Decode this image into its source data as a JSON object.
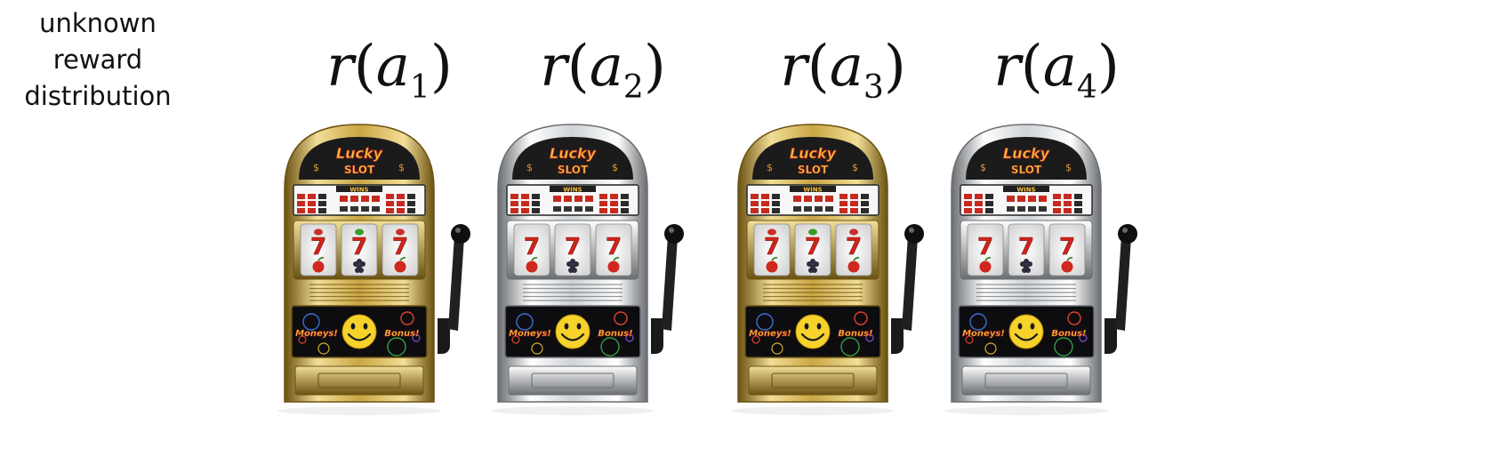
{
  "side_label": {
    "lines": [
      "unknown",
      "reward",
      "distribution"
    ]
  },
  "machines": [
    {
      "fn": "r",
      "arg": "a",
      "sub": "1",
      "finish": "gold",
      "sign_top": "Lucky",
      "sign_bottom": "SLOT",
      "wins": "WINS",
      "panel_left": "Moneys!",
      "panel_right": "Bonus!"
    },
    {
      "fn": "r",
      "arg": "a",
      "sub": "2",
      "finish": "silver",
      "sign_top": "Lucky",
      "sign_bottom": "SLOT",
      "wins": "WINS",
      "panel_left": "Moneys!",
      "panel_right": "Bonus!"
    },
    {
      "fn": "r",
      "arg": "a",
      "sub": "3",
      "finish": "gold",
      "sign_top": "Lucky",
      "sign_bottom": "SLOT",
      "wins": "WINS",
      "panel_left": "Moneys!",
      "panel_right": "Bonus!"
    },
    {
      "fn": "r",
      "arg": "a",
      "sub": "4",
      "finish": "silver",
      "sign_top": "Lucky",
      "sign_bottom": "SLOT",
      "wins": "WINS",
      "panel_left": "Moneys!",
      "panel_right": "Bonus!"
    }
  ],
  "reel_symbols": [
    "7",
    "7",
    "7"
  ],
  "colors": {
    "gold": {
      "light": "#f2de97",
      "mid": "#c9a544",
      "dark": "#6b5212"
    },
    "silver": {
      "light": "#ffffff",
      "mid": "#cfd3d6",
      "dark": "#6a6e72"
    },
    "seven": "#d1241b",
    "sign_text": "#f5c13a",
    "smiley": "#f6d22b"
  }
}
